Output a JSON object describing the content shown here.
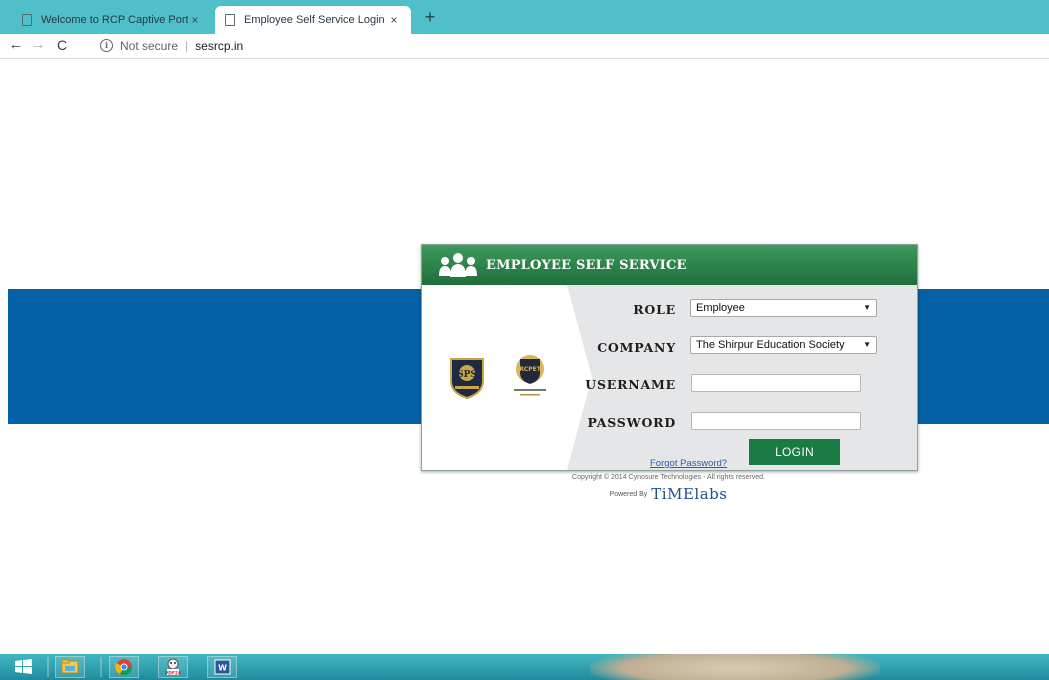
{
  "browser": {
    "tabs": [
      {
        "label": "Welcome to RCP Captive Portal",
        "active": false
      },
      {
        "label": "Employee Self Service Login",
        "active": true
      }
    ],
    "close_glyph": "×",
    "new_tab_glyph": "+",
    "nav": {
      "back": "←",
      "forward": "→",
      "reload": "C"
    },
    "address": {
      "security": "Not secure",
      "separator": "|",
      "url": "sesrcp.in"
    }
  },
  "login": {
    "title": "EMPLOYEE SELF SERVICE",
    "role": {
      "label": "ROLE",
      "value": "Employee"
    },
    "company": {
      "label": "COMPANY",
      "value": "The Shirpur Education Society"
    },
    "username": {
      "label": "USERNAME",
      "value": ""
    },
    "password": {
      "label": "PASSWORD",
      "value": ""
    },
    "login_button": "LOGIN",
    "forgot_link": "Forgot Password?",
    "logos": [
      "SPS",
      "RCPET"
    ]
  },
  "footer": {
    "copyright": "Copyright © 2014 Cynosure Technologies - All rights reserved.",
    "powered_by": "Powered By",
    "brand": "TiMElabs"
  },
  "taskbar": {
    "items": [
      "windows-start-icon",
      "file-explorer-icon",
      "chrome-icon",
      "pdf24-icon",
      "word-icon"
    ],
    "pdf_label": "PDF24"
  },
  "colors": {
    "tab_bar": "#4fbfc9",
    "blue_band": "#0461a6",
    "header_green": "#1f6e3a",
    "login_button": "#1a7b44"
  }
}
